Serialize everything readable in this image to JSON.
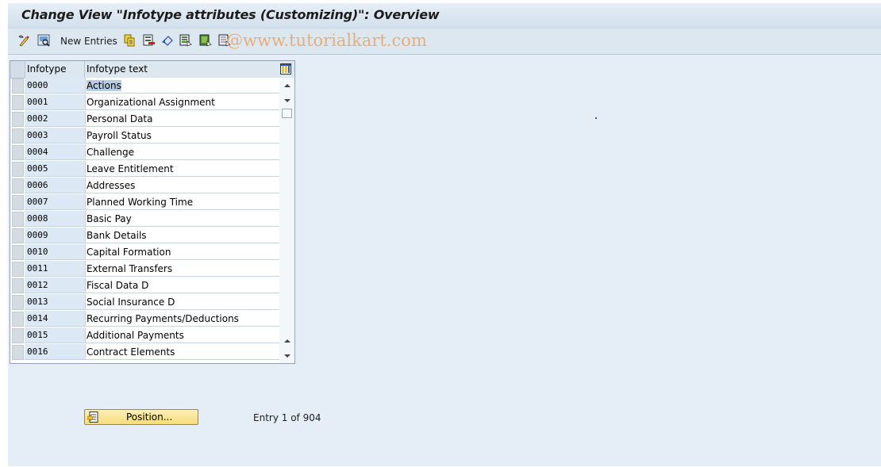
{
  "window": {
    "title": "Change View \"Infotype attributes (Customizing)\": Overview"
  },
  "toolbar": {
    "icons": [
      "display-change-icon",
      "select-all-icon"
    ],
    "new_entries_label": "New Entries",
    "right_icons": [
      "copy-as-icon",
      "delete-icon",
      "undo-change-icon",
      "select-all-rows-icon",
      "select-block-icon",
      "deselect-all-icon"
    ],
    "watermark": "@www.tutorialkart.com"
  },
  "table": {
    "columns": [
      "Infotype",
      "Infotype text"
    ],
    "rows": [
      {
        "infotype": "0000",
        "text": "Actions"
      },
      {
        "infotype": "0001",
        "text": "Organizational Assignment"
      },
      {
        "infotype": "0002",
        "text": "Personal Data"
      },
      {
        "infotype": "0003",
        "text": "Payroll Status"
      },
      {
        "infotype": "0004",
        "text": "Challenge"
      },
      {
        "infotype": "0005",
        "text": "Leave Entitlement"
      },
      {
        "infotype": "0006",
        "text": "Addresses"
      },
      {
        "infotype": "0007",
        "text": "Planned Working Time"
      },
      {
        "infotype": "0008",
        "text": "Basic Pay"
      },
      {
        "infotype": "0009",
        "text": "Bank Details"
      },
      {
        "infotype": "0010",
        "text": "Capital Formation"
      },
      {
        "infotype": "0011",
        "text": "External Transfers"
      },
      {
        "infotype": "0012",
        "text": "Fiscal Data  D"
      },
      {
        "infotype": "0013",
        "text": "Social Insurance  D"
      },
      {
        "infotype": "0014",
        "text": "Recurring Payments/Deductions"
      },
      {
        "infotype": "0015",
        "text": "Additional Payments"
      },
      {
        "infotype": "0016",
        "text": "Contract Elements"
      }
    ],
    "selected_row": 0
  },
  "footer": {
    "position_button": "Position...",
    "entry_info": "Entry 1 of 904"
  }
}
